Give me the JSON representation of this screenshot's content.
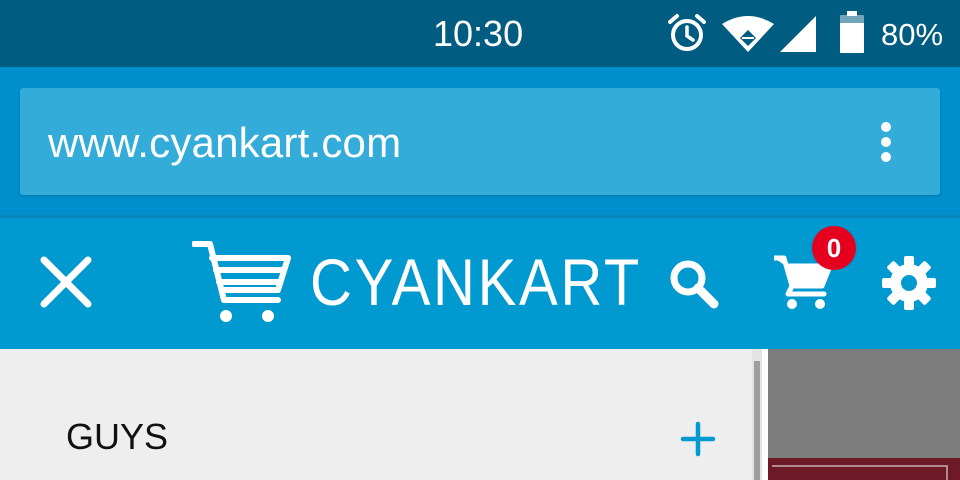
{
  "status_bar": {
    "time": "10:30",
    "battery_percent": "80%",
    "battery_level": 0.8,
    "icons": [
      "alarm-icon",
      "wifi-icon",
      "cell-signal-icon",
      "battery-icon"
    ]
  },
  "browser": {
    "url": "www.cyankart.com",
    "menu_icon": "overflow-menu-icon"
  },
  "site_header": {
    "brand_name": "CYANKART",
    "brand_icon": "cart-logo-icon",
    "close_icon": "close-icon",
    "search_icon": "search-icon",
    "cart_icon": "cart-icon",
    "cart_count": "0",
    "settings_icon": "gear-icon"
  },
  "side_menu": {
    "items": [
      {
        "label": "GUYS",
        "expand_icon": "plus-icon"
      }
    ]
  },
  "colors": {
    "status_bar": "#005c80",
    "browser_bar": "#008fcb",
    "url_box": "#34acd9",
    "header": "#0099d0",
    "badge": "#e6001f",
    "menu_bg": "#eeeeee",
    "accent": "#0099d0"
  }
}
